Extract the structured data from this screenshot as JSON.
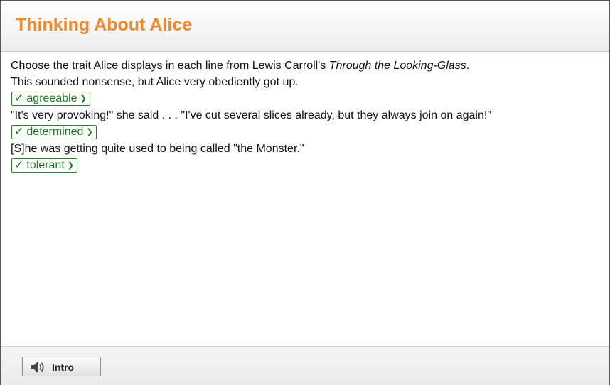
{
  "header": {
    "title": "Thinking About Alice"
  },
  "instructions": {
    "prefix": "Choose the trait Alice displays in each line from Lewis Carroll's ",
    "book": "Through the Looking-Glass",
    "suffix": "."
  },
  "questions": [
    {
      "quote": "This sounded nonsense, but Alice very obediently got up.",
      "answer": "agreeable",
      "check": "✓",
      "status": "correct"
    },
    {
      "quote": "\"It's very provoking!\" she said . . . \"I've cut several slices already, but they always join on again!\"",
      "answer": "determined",
      "check": "✓",
      "status": "correct"
    },
    {
      "quote": "[S]he was getting quite used to being called \"the Monster.\"",
      "answer": "tolerant",
      "check": "✓",
      "status": "correct"
    }
  ],
  "footer": {
    "intro_label": "Intro",
    "intro_icon": "speaker-icon"
  },
  "colors": {
    "title": "#ec8a2f",
    "correct": "#1f7a1f"
  }
}
